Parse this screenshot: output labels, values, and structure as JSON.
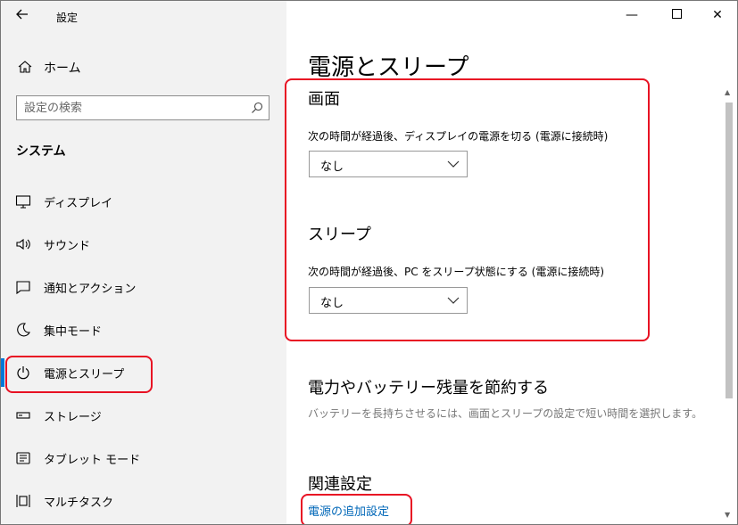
{
  "window": {
    "title": "設定"
  },
  "sidebar": {
    "home_label": "ホーム",
    "search_placeholder": "設定の検索",
    "section_title": "システム",
    "items": [
      {
        "label": "ディスプレイ",
        "icon": "monitor-icon"
      },
      {
        "label": "サウンド",
        "icon": "speaker-icon"
      },
      {
        "label": "通知とアクション",
        "icon": "notification-icon"
      },
      {
        "label": "集中モード",
        "icon": "moon-icon"
      },
      {
        "label": "電源とスリープ",
        "icon": "power-icon",
        "active": true
      },
      {
        "label": "ストレージ",
        "icon": "storage-icon"
      },
      {
        "label": "タブレット モード",
        "icon": "tablet-icon"
      },
      {
        "label": "マルチタスク",
        "icon": "multitask-icon"
      }
    ]
  },
  "main": {
    "title": "電源とスリープ",
    "screen": {
      "heading": "画面",
      "label": "次の時間が経過後、ディスプレイの電源を切る (電源に接続時)",
      "value": "なし"
    },
    "sleep": {
      "heading": "スリープ",
      "label": "次の時間が経過後、PC をスリープ状態にする (電源に接続時)",
      "value": "なし"
    },
    "save_power": {
      "heading": "電力やバッテリー残量を節約する",
      "description": "バッテリーを長持ちさせるには、画面とスリープの設定で短い時間を選択します。"
    },
    "related": {
      "heading": "関連設定",
      "link": "電源の追加設定"
    }
  },
  "colors": {
    "accent": "#0078d7",
    "highlight": "#e81123",
    "link": "#0067b8"
  }
}
